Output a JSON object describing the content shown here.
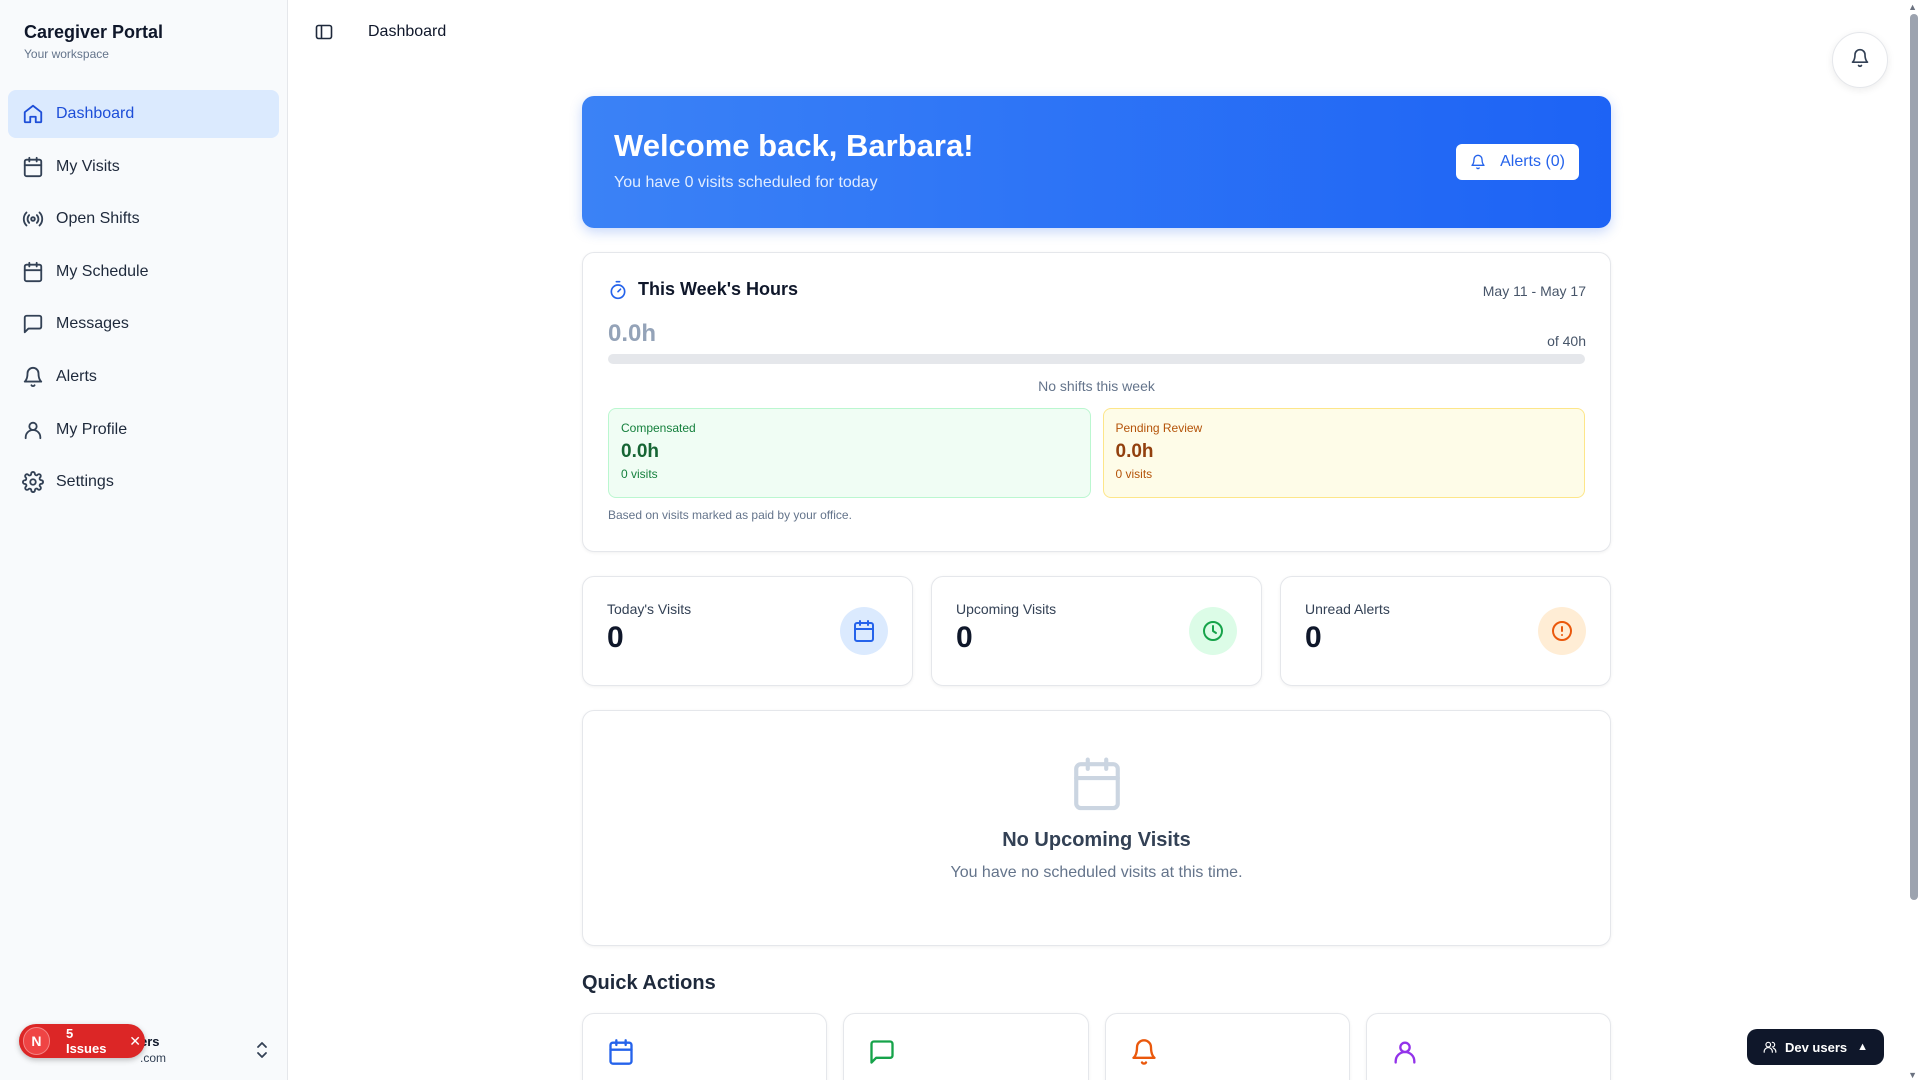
{
  "app": {
    "title": "Caregiver Portal",
    "subtitle": "Your workspace"
  },
  "sidebar": {
    "items": [
      {
        "label": "Dashboard",
        "icon": "home-icon",
        "active": true
      },
      {
        "label": "My Visits",
        "icon": "calendar-icon"
      },
      {
        "label": "Open Shifts",
        "icon": "broadcast-icon"
      },
      {
        "label": "My Schedule",
        "icon": "calendar-icon"
      },
      {
        "label": "Messages",
        "icon": "message-icon"
      },
      {
        "label": "Alerts",
        "icon": "bell-icon"
      },
      {
        "label": "My Profile",
        "icon": "user-icon"
      },
      {
        "label": "Settings",
        "icon": "gear-icon"
      }
    ],
    "user": {
      "name_fragment": "ers",
      "email_fragment": ".com"
    }
  },
  "issues": {
    "initial": "N",
    "label": "5 Issues"
  },
  "header": {
    "title": "Dashboard"
  },
  "welcome": {
    "title": "Welcome back, Barbara!",
    "subtitle": "You have 0 visits scheduled for today",
    "alerts_button": "Alerts (0)"
  },
  "hours": {
    "title": "This Week's Hours",
    "range": "May 11 - May 17",
    "value": "0.0h",
    "of_total": "of 40h",
    "progress": 0,
    "empty_text": "No shifts this week",
    "compensated": {
      "label": "Compensated",
      "value": "0.0h",
      "count": "0 visits"
    },
    "pending": {
      "label": "Pending Review",
      "value": "0.0h",
      "count": "0 visits"
    },
    "note": "Based on visits marked as paid by your office."
  },
  "stats": [
    {
      "label": "Today's Visits",
      "value": "0",
      "icon": "calendar-icon",
      "color": "#2563eb",
      "bg": "#dbeafe"
    },
    {
      "label": "Upcoming Visits",
      "value": "0",
      "icon": "clock-icon",
      "color": "#16a34a",
      "bg": "#dcfce7"
    },
    {
      "label": "Unread Alerts",
      "value": "0",
      "icon": "alert-circle-icon",
      "color": "#ea580c",
      "bg": "#ffedd5"
    }
  ],
  "empty": {
    "title": "No Upcoming Visits",
    "subtitle": "You have no scheduled visits at this time."
  },
  "quick_actions": {
    "title": "Quick Actions",
    "items": [
      {
        "icon": "calendar-icon",
        "color": "#2563eb"
      },
      {
        "icon": "message-icon",
        "color": "#16a34a"
      },
      {
        "icon": "bell-icon",
        "color": "#ea580c"
      },
      {
        "icon": "user-icon",
        "color": "#9333ea"
      }
    ]
  },
  "dev_users": {
    "label": "Dev users"
  },
  "colors": {
    "accent": "#2563eb",
    "success": "#16a34a",
    "warning": "#ea580c",
    "purple": "#9333ea"
  }
}
